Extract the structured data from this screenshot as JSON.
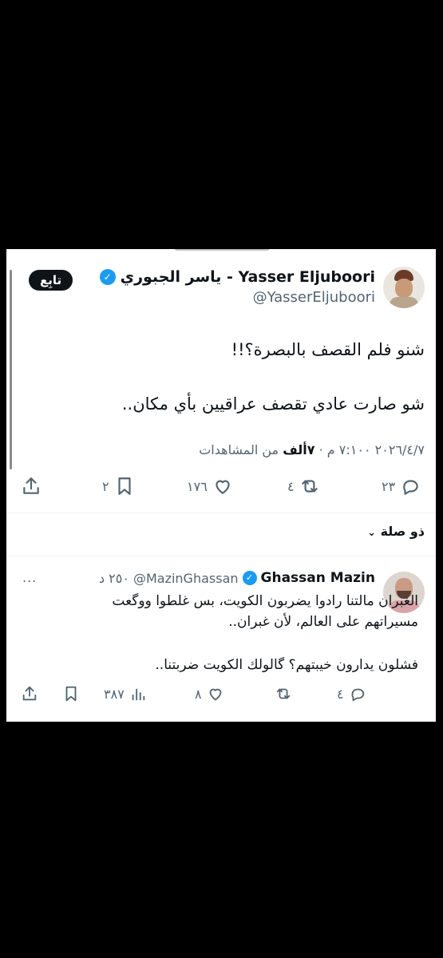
{
  "tweet": {
    "author_name": "Yasser Eljuboori - ياسر الجبوري",
    "author_handle": "@YasserEljuboori",
    "verified_mark": "✓",
    "follow_label": "تابِع",
    "text_line1": "شنو فلم القصف بالبصرة؟!!",
    "text_line2": "شو صارت عادي تقصف عراقيين بأي مكان..",
    "time": "٧:١٠٠ م",
    "date": "٢٠٢٦/٤/٧",
    "views_count": "٧ألف",
    "views_label": "من المشاهدات",
    "reply_count": "٢٣",
    "retweet_count": "٤",
    "like_count": "١٧٦",
    "bookmark_count": "٢",
    "icons": [
      "reply-icon",
      "retweet-icon",
      "like-icon",
      "bookmark-icon",
      "share-icon"
    ]
  },
  "thread": {
    "label": "ذو صلة"
  },
  "reply": {
    "author_name": "Ghassan Mazin",
    "author_handle": "@MazinGhassan",
    "time": "٢٥٠ د",
    "more": "...",
    "text_line1": "الغبران مالتنا رادوا يضربون الكويت، بس غلطوا ووگعت",
    "text_line2": "مسيراتهم على العالم، لأن غبران..",
    "text_line3": "فشلون يدارون خيبتهم؟ گالولك الكويت ضربتنا..",
    "reply_count": "٤",
    "like_count": "٨",
    "views_count": "٣٨٧"
  },
  "colors": {
    "verified": "#1d9bf0",
    "text": "#0f1419",
    "secondary": "#536471",
    "background": "#000000"
  }
}
